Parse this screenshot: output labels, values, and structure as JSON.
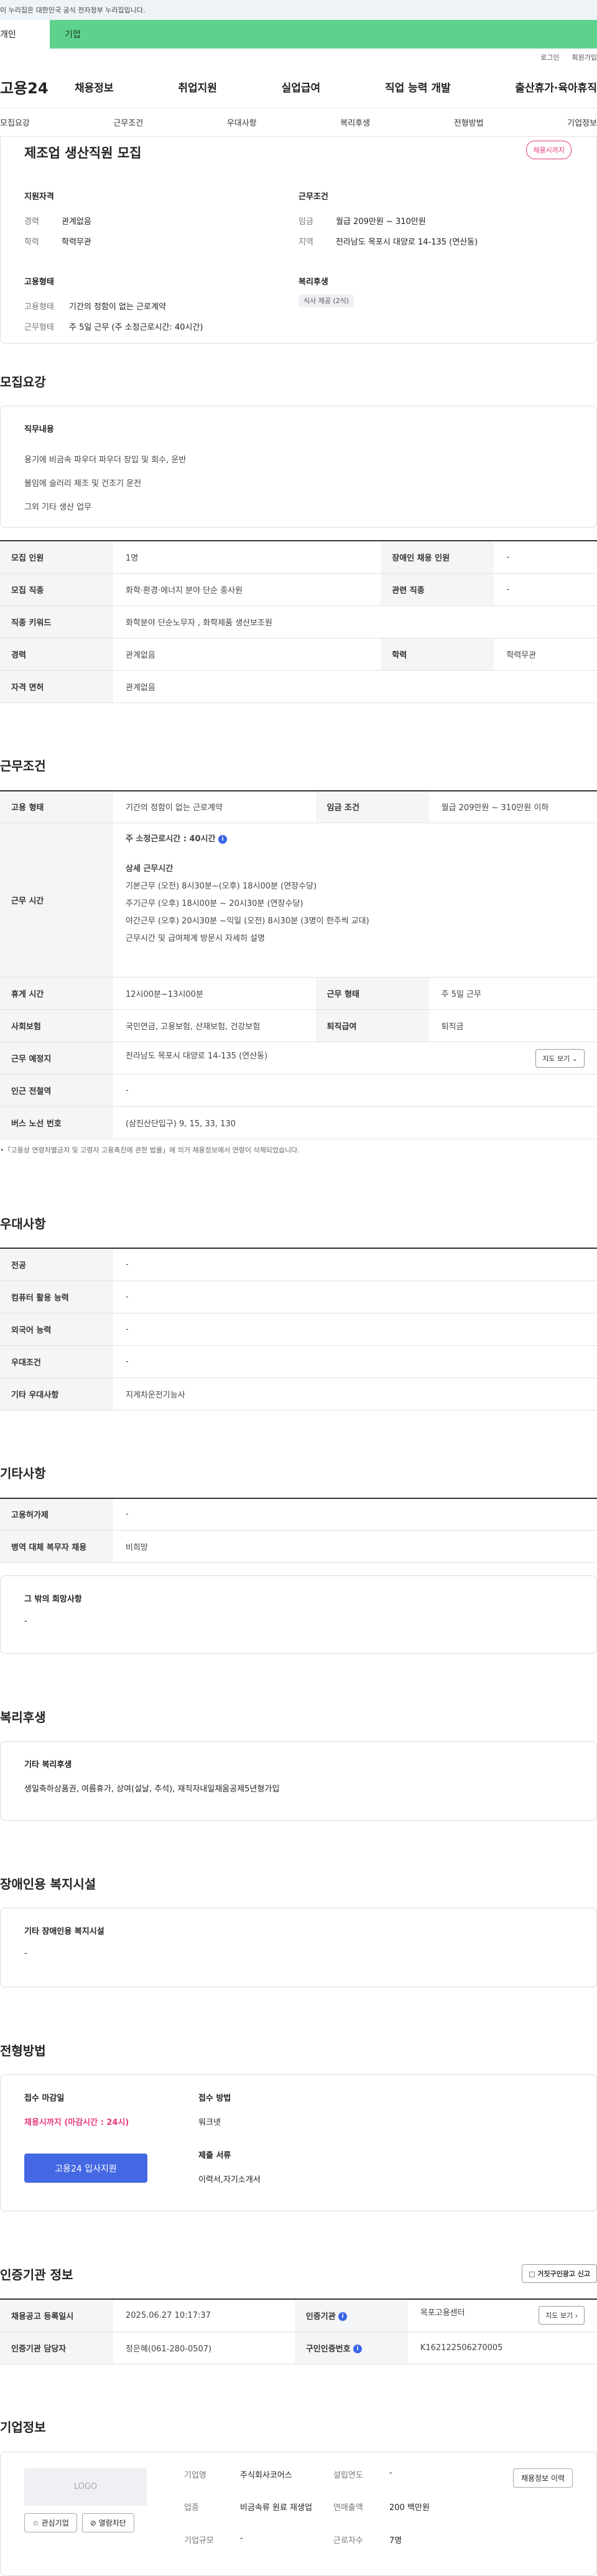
{
  "gov_banner": "이 누리집은 대한민국 공식 전자정부 누리집입니다.",
  "audience_tabs": {
    "individual": "개인",
    "company": "기업"
  },
  "util": {
    "login": "로그인",
    "signup": "회원가입"
  },
  "logo": "고용24",
  "gnb": [
    "채용정보",
    "취업지원",
    "실업급여",
    "직업 능력 개발",
    "출산휴가·육아휴직"
  ],
  "anchors": [
    "모집요강",
    "근무조건",
    "우대사항",
    "복리후생",
    "전형방법",
    "기업정보"
  ],
  "summary": {
    "title": "제조업 생산직원 모집",
    "badge": "채용시까지",
    "qual_head": "지원자격",
    "qual": [
      {
        "k": "경력",
        "v": "관계없음"
      },
      {
        "k": "학력",
        "v": "학력무관"
      }
    ],
    "cond_head": "근무조건",
    "cond": [
      {
        "k": "임금",
        "v": "월급 209만원 ~ 310만원"
      },
      {
        "k": "지역",
        "v": "전라남도 목포시 대양로 14-135 (연산동)"
      }
    ],
    "emp_head": "고용형태",
    "emp": [
      {
        "k": "고용형태",
        "v": "기간의 정함이 없는 근로계약"
      },
      {
        "k": "근무형태",
        "v": "주 5일 근무 (주 소정근로시간: 40시간)"
      }
    ],
    "welfare_head": "복리후생",
    "welfare_tag": "식사 제공 (2식)"
  },
  "recruit": {
    "title": "모집요강",
    "duty_head": "직무내용",
    "duties": [
      "용기에 비금속 파우더 파우더 장입 및 회수, 운반",
      "불임에 슬러리 제조 및 건조기 운전",
      "그외 기타 생산 업무"
    ],
    "rows": [
      {
        "k1": "모집 인원",
        "v1": "1명",
        "k2": "장애인 채용 인원",
        "v2": "-"
      },
      {
        "k1": "모집 직종",
        "v1": "화학·환경·에너지 분야 단순 종사원",
        "k2": "관련 직종",
        "v2": "-"
      },
      {
        "k1": "직종 키워드",
        "v1": "화학분야 단순노무자 , 화학제품 생산보조원"
      },
      {
        "k1": "경력",
        "v1": "관계없음",
        "k2": "학력",
        "v2": "학력무관"
      },
      {
        "k1": "자격 면허",
        "v1": "관계없음"
      }
    ]
  },
  "conditions": {
    "title": "근무조건",
    "employ_type_k": "고용 형태",
    "employ_type_v": "기간의 정함이 없는 근로계약",
    "wage_k": "임금 조건",
    "wage_v": "월급 209만원 ~ 310만원 이하",
    "hours_k": "근무 시간",
    "hours_main": "주 소정근로시간 : 40시간",
    "hours_detail_head": "상세 근무시간",
    "hours_lines": [
      "기본근무 (오전) 8시30분~(오후) 18시00분 (연장수당)",
      "주기근무 (오후) 18시00분 ~ 20시30분 (연장수당)",
      "야간근무 (오후) 20시30분 ~익일 (오전) 8시30분 (3명이 한주씩 교대)",
      "근무시간 및 급여체계 방문시 자세히 설명"
    ],
    "break_k": "휴게 시간",
    "break_v": "12시00분~13시00분",
    "work_form_k": "근무 형태",
    "work_form_v": "주 5일 근무",
    "insurance_k": "사회보험",
    "insurance_v": "국민연금, 고용보험, 산재보험, 건강보험",
    "severance_k": "퇴직급여",
    "severance_v": "퇴직금",
    "location_k": "근무 예정지",
    "location_v": "전라남도 목포시 대양로 14-135 (연산동)",
    "map_btn": "지도 보기",
    "subway_k": "인근 전철역",
    "subway_v": "-",
    "bus_k": "버스 노선 번호",
    "bus_v": "(삼진산단입구) 9, 15, 33, 130",
    "note": "「고용상 연령차별금지 및 고령자 고용촉진에 관한 법률」에 의거 채용정보에서 연령이 삭제되었습니다."
  },
  "preference": {
    "title": "우대사항",
    "rows": [
      {
        "k": "전공",
        "v": "-"
      },
      {
        "k": "컴퓨터 활용 능력",
        "v": "-"
      },
      {
        "k": "외국어 능력",
        "v": "-"
      },
      {
        "k": "우대조건",
        "v": "-"
      },
      {
        "k": "기타 우대사항",
        "v": "지게차운전기능사"
      }
    ]
  },
  "etc": {
    "title": "기타사항",
    "rows": [
      {
        "k": "고용허가제",
        "v": "-"
      },
      {
        "k": "병역 대체 복무자 채용",
        "v": "비희망"
      }
    ],
    "other_head": "그 밖의 희망사항",
    "other_v": "-"
  },
  "welfare": {
    "title": "복리후생",
    "head": "기타 복리후생",
    "value": "생일축하상품권, 여름휴가, 상여(설날, 추석), 재직자내일채움공제5년형가입"
  },
  "disability": {
    "title": "장애인용 복지시설",
    "head": "기타 장애인용 복지시설",
    "value": "-"
  },
  "selection": {
    "title": "전형방법",
    "deadline_head": "접수 마감일",
    "deadline_v": "채용시까지 (마감시간 : 24시)",
    "apply_btn": "고용24 입사지원",
    "method_head": "접수 방법",
    "method_v": "워크넷",
    "docs_head": "제출 서류",
    "docs_v": "이력서,자기소개서"
  },
  "certification": {
    "title": "인증기관 정보",
    "report_btn": "거짓구인광고 신고",
    "rows": [
      {
        "k1": "채용공고 등록일시",
        "v1": "2025.06.27 10:17:37",
        "k2": "인증기관",
        "v2": "목포고용센터",
        "btn": "지도 보기"
      },
      {
        "k1": "인증기관 담당자",
        "v1": "정은혜(061-280-0507)",
        "k2": "구인인증번호",
        "v2": "K162122506270005"
      }
    ]
  },
  "company": {
    "title": "기업정보",
    "logo": "LOGO",
    "fav_btn": "관심기업",
    "block_btn": "열람차단",
    "name_k": "기업명",
    "name_v": "주식회사코어스",
    "industry_k": "업종",
    "industry_v": "비금속류 원료 재생업",
    "size_k": "기업규모",
    "size_v": "-",
    "founded_k": "설립연도",
    "founded_v": "-",
    "sales_k": "연매출액",
    "sales_v": "200 백만원",
    "staff_k": "근로자수",
    "staff_v": "7명",
    "history_btn": "채용정보 이력"
  }
}
